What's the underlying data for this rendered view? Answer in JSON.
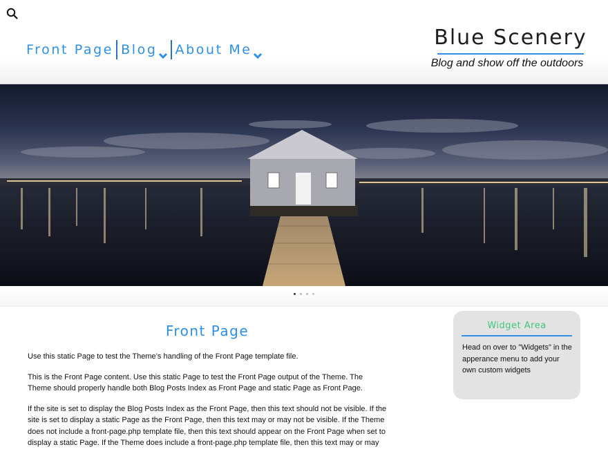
{
  "header": {
    "search_icon": "search-icon",
    "nav": [
      {
        "label": "Front Page",
        "has_dropdown": false
      },
      {
        "label": "Blog",
        "has_dropdown": true
      },
      {
        "label": "About Me",
        "has_dropdown": true
      }
    ],
    "site_title": "Blue Scenery",
    "tagline": "Blog and show off the outdoors"
  },
  "slider": {
    "slide_count": 4,
    "active_slide": 1
  },
  "main": {
    "title": "Front Page",
    "paragraphs": [
      "Use this static Page to test the Theme’s handling of the Front Page template file.",
      "This is the Front Page content. Use this static Page to test the Front Page output of the Theme. The Theme should properly handle both Blog Posts Index as Front Page and static Page as Front Page.",
      "If the site is set to display the Blog Posts Index as the Front Page, then this text should not be visible. If the site is set to display a static Page as the Front Page, then this text may or may not be visible. If the Theme does not include a front-page.php template file, then this text should appear on the Front Page when set to display a static Page. If the Theme does include a front-page.php template file, then this text may or may"
    ]
  },
  "widget": {
    "title": "Widget Area",
    "text": "Head on over to \"Widgets\" in the apperance menu to add your own custom widgets"
  },
  "colors": {
    "accent": "#2e8fe6",
    "widget_title": "#3ec77a",
    "widget_bg": "#e3e3e3"
  }
}
